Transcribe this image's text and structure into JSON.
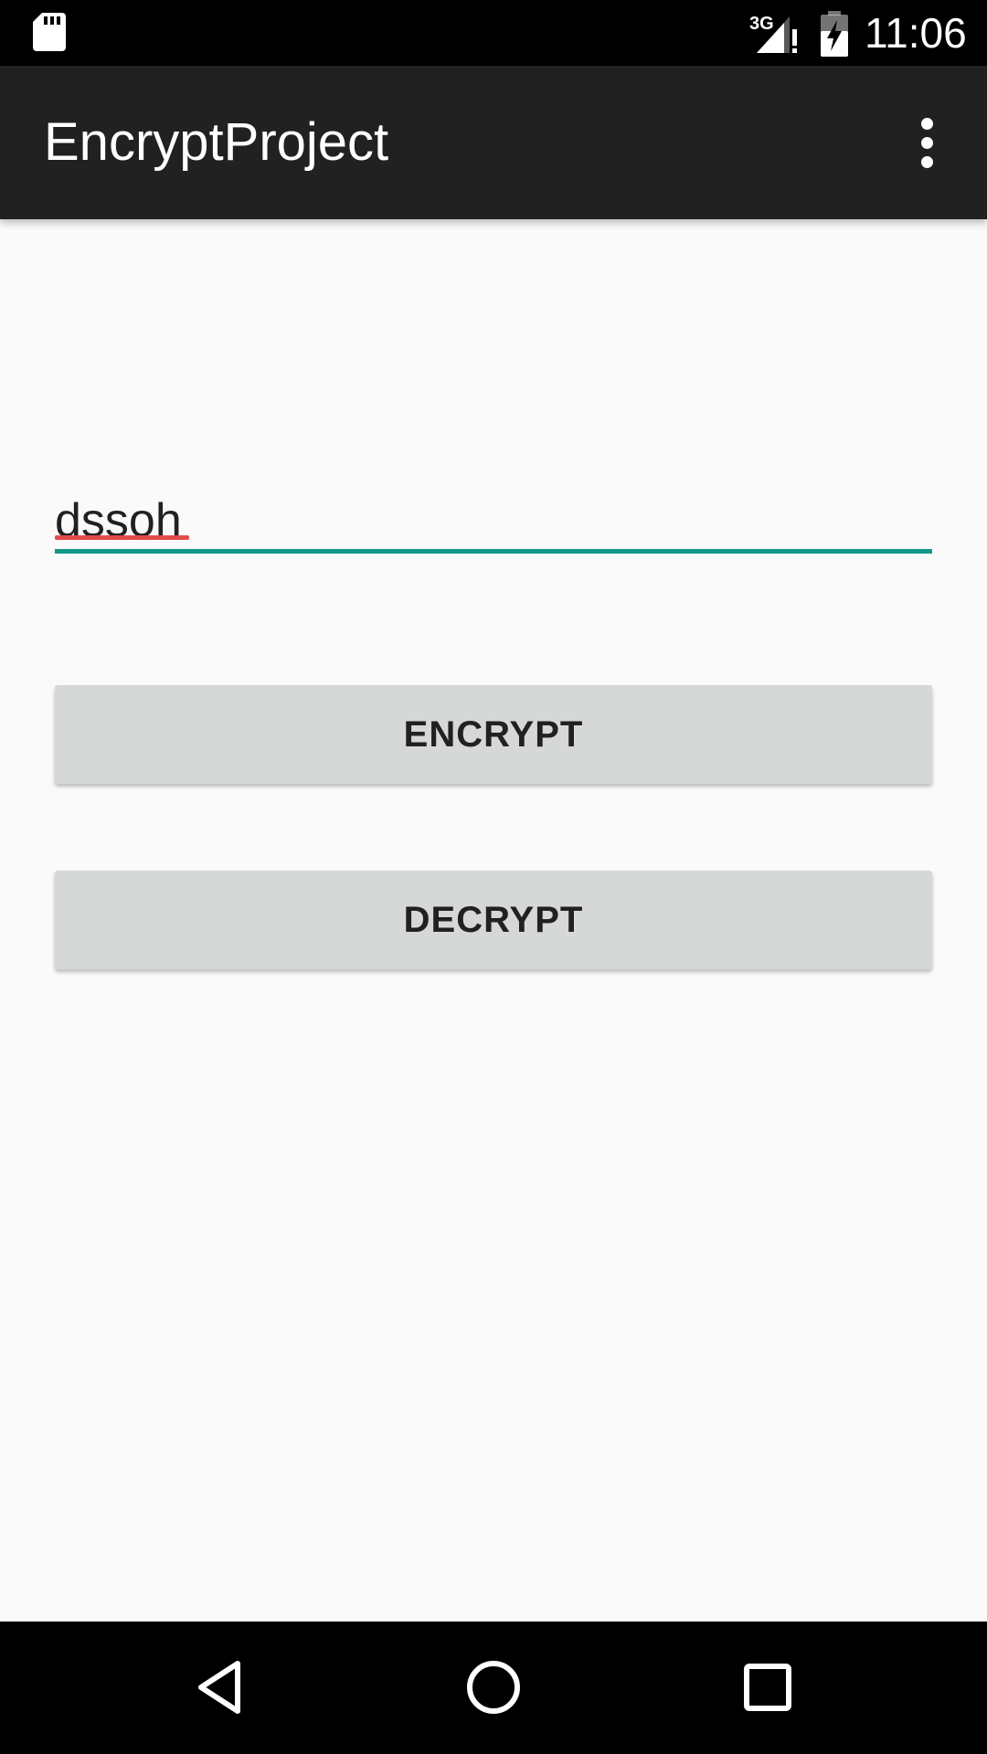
{
  "status_bar": {
    "time": "11:06",
    "network_label": "3G",
    "icons": [
      "sd-card-icon",
      "signal-icon",
      "battery-charging-icon"
    ]
  },
  "app_bar": {
    "title": "EncryptProject",
    "menu_icon": "more-vert-icon"
  },
  "main": {
    "input": {
      "value": "dssoh",
      "placeholder": ""
    },
    "buttons": {
      "encrypt_label": "ENCRYPT",
      "decrypt_label": "DECRYPT"
    }
  },
  "nav_bar": {
    "icons": [
      "back-icon",
      "home-icon",
      "recents-icon"
    ]
  },
  "colors": {
    "status_bar": "#000000",
    "app_bar": "#212121",
    "background": "#fafafa",
    "accent": "#139787",
    "spellcheck": "#e34a4a",
    "button": "#d6d7d7"
  }
}
